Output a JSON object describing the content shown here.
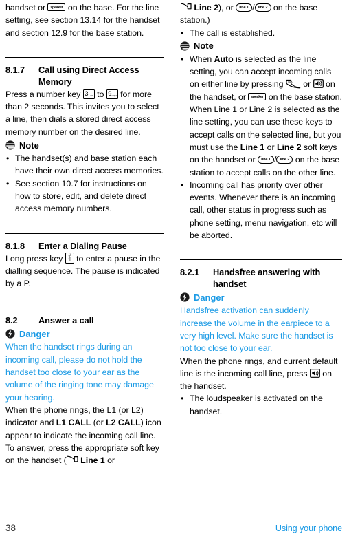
{
  "page": {
    "number": "38",
    "footer_title": "Using your phone",
    "accent_blue": "#1a9ae5"
  },
  "left_column": {
    "continued_paragraph": "handset or  on the base. For the line setting, see section 13.14 for the handset and section 12.9 for the base station.",
    "continued_parts": {
      "p1": "handset or",
      "key_speaker": "speaker",
      "p2": "on the base. For the line setting, see section 13.14 for the handset and section 12.9 for the base station."
    },
    "section_817": {
      "number": "8.1.7",
      "title_line1": "Call using Direct Access",
      "title_line2": "Memory",
      "body_p1": "Press a number key",
      "key3_digit": "3",
      "key3_sub": "def",
      "body_p2": "to",
      "key9_digit": "9",
      "key9_sub": "wxyz",
      "body_p3": "for more than 2 seconds. This invites you to select a line, then dials a stored direct access memory number on the desired line.",
      "note_label": "Note",
      "note_bullets": [
        "The handset(s) and base station each have their own direct access memories.",
        "See section 10.7 for instructions on how to store, edit, and delete direct access memory numbers."
      ]
    },
    "section_818": {
      "number": "8.1.8",
      "title": "Enter a Dialing Pause",
      "body_p1": "Long press key",
      "key_hash_top": "#",
      "key_hash_bottom": "¶",
      "body_p2": "to enter a pause in the dialling sequence. The pause is indicated by a P."
    },
    "section_82": {
      "number": "8.2",
      "title": "Answer a call",
      "danger_label": "Danger",
      "danger_text": "When the handset rings during an incoming call, please do not hold the handset too close to your ear as the volume of the ringing tone may damage your hearing.",
      "body_p1": "When the phone rings, the L1 (or L2) indicator  and ",
      "bold1": "L1 CALL",
      "body_p2": " (or ",
      "bold2": "L2 CALL",
      "body_p3": ") icon appear to indicate the incoming call line. To answer, press the appropriate soft key on the handset (",
      "bold3": "Line 1",
      "body_p4": " or"
    }
  },
  "right_column": {
    "continued": {
      "bold_line2": "Line 2",
      "p1": "), or",
      "key_line1": "line 1",
      "key_sep": "/",
      "key_line2": "line 2",
      "p2": "on the base station.)"
    },
    "bullet_established": "The call is established.",
    "note_label": "Note",
    "note_bullets": {
      "b1_p1": "When",
      "b1_bold1": "Auto",
      "b1_p2": "is selected as the line setting, you can accept incoming calls on either line by pressing",
      "b1_key_talk": "TALK",
      "b1_or": "or",
      "b1_key_loud": "loudspeaker",
      "b1_p3": "on the handset, or",
      "b1_key_speaker": "speaker",
      "b1_p4": "on the base station. When Line 1 or Line 2 is selected as the line setting, you can use these keys to accept calls on the selected line, but you must use the",
      "b1_bold2": "Line 1",
      "b1_or2": "or",
      "b1_bold3": "Line 2",
      "b1_p5": "soft keys on the handset or",
      "b1_key_line1": "line 1",
      "b1_key_line2": "line 2",
      "b1_p6": "on the base station to accept calls on the other line.",
      "b2": "Incoming call has priority over other events. Whenever there is an incoming call, other status in progress such as phone setting, menu navigation, etc will be aborted."
    },
    "section_821": {
      "number": "8.2.1",
      "title_line1": "Handsfree answering with",
      "title_line2": "handset",
      "danger_label": "Danger",
      "danger_text": "Handsfree activation can suddenly increase the volume in the earpiece to a very high level. Make sure the handset is not too close to your ear.",
      "body_p1": "When the phone rings, and current default line is the incoming call line, press",
      "key_loud": "loudspeaker",
      "body_p2": "on the handset.",
      "bullet": "The loudspeaker is activated on the handset."
    }
  }
}
